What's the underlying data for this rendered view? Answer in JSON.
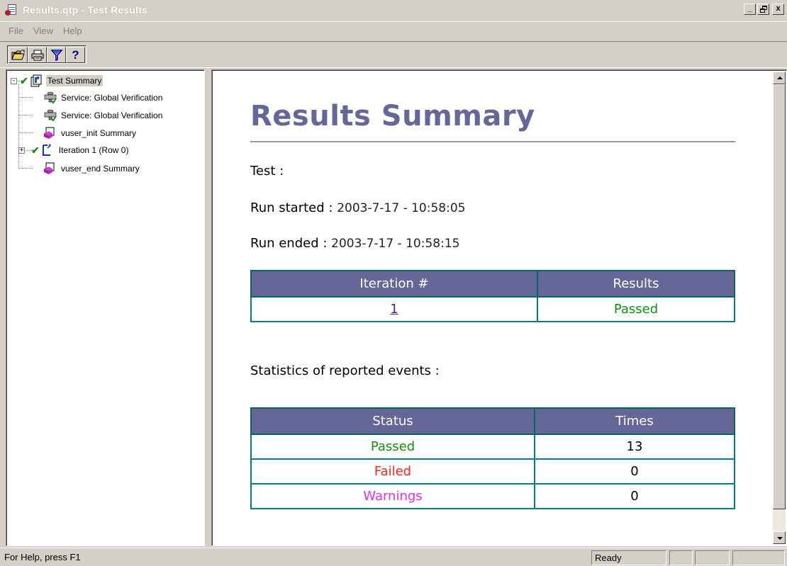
{
  "window": {
    "title": "Results.qtp - Test Results",
    "buttons": {
      "minimize": "_",
      "maximize": "🗗",
      "close": "x"
    }
  },
  "menu": [
    {
      "label": "File",
      "accel": "F"
    },
    {
      "label": "View",
      "accel": "V"
    },
    {
      "label": "Help",
      "accel": "H"
    }
  ],
  "toolbar": {
    "buttons": [
      {
        "name": "open-icon"
      },
      {
        "name": "print-icon"
      },
      {
        "name": "filter-icon"
      },
      {
        "name": "help-icon",
        "label": "?"
      }
    ]
  },
  "tree": [
    {
      "label": "Test Summary",
      "icon": "test-summary-icon",
      "checked": true,
      "expander": "-",
      "selected": true
    },
    {
      "label": "Service: Global Verification",
      "icon": "service-icon"
    },
    {
      "label": "Service: Global Verification",
      "icon": "service-icon"
    },
    {
      "label": "vuser_init Summary",
      "icon": "action-icon"
    },
    {
      "label": "Iteration 1 (Row 0)",
      "icon": "iteration-icon",
      "checked": true,
      "expander": "+"
    },
    {
      "label": "vuser_end Summary",
      "icon": "action-icon"
    }
  ],
  "summary": {
    "title": "Results Summary",
    "test_label": "Test :",
    "test_value": "",
    "run_started_label": "Run started :",
    "run_started_value": "2003-7-17 - 10:58:05",
    "run_ended_label": "Run ended :",
    "run_ended_value": "2003-7-17 - 10:58:15",
    "iter_table": {
      "headers": [
        "Iteration #",
        "Results"
      ],
      "rows": [
        {
          "iteration": "1",
          "result": "Passed"
        }
      ]
    },
    "stats_heading": "Statistics of reported events :",
    "stats_table": {
      "headers": [
        "Status",
        "Times"
      ],
      "rows": [
        {
          "status": "Passed",
          "times": "13"
        },
        {
          "status": "Failed",
          "times": "0"
        },
        {
          "status": "Warnings",
          "times": "0"
        }
      ]
    }
  },
  "colors": {
    "header_bg": "#666699",
    "passed": "#109010",
    "failed": "#ff2020",
    "warnings": "#e030e0",
    "border": "#008080"
  },
  "statusbar": {
    "help_text": "For Help, press F1",
    "state": "Ready"
  }
}
